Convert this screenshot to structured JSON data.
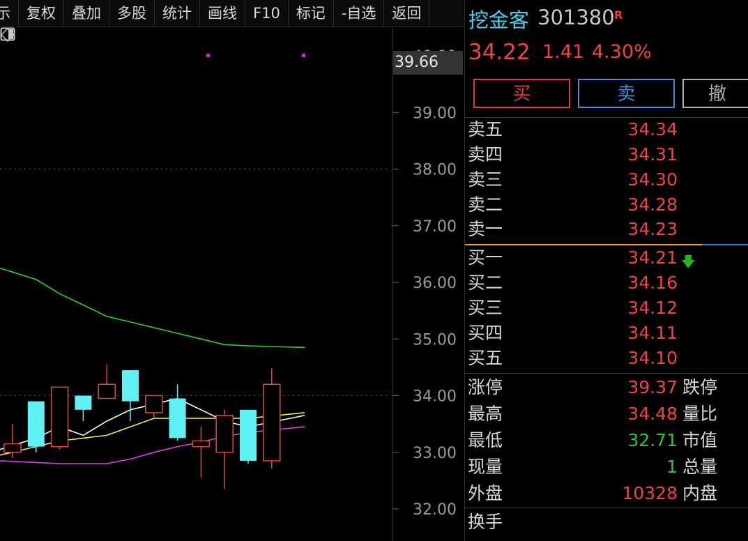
{
  "toolbar": {
    "items": [
      "示",
      "复权",
      "叠加",
      "多股",
      "统计",
      "画线",
      "F10",
      "标记",
      "-自选",
      "返回"
    ]
  },
  "chart": {
    "y_ticks": [
      "39.00",
      "38.00",
      "37.00",
      "36.00",
      "35.00",
      "34.00",
      "33.00",
      "32.00"
    ],
    "top_tick": "40.00",
    "current_label": "39.66",
    "colors": {
      "up": "#e04a3a",
      "down": "#5ff0f4",
      "ma_white": "#ffffff",
      "ma_yellow": "#f0f060",
      "ma_magenta": "#e040e0",
      "ma_green": "#30d030"
    }
  },
  "chart_data": {
    "type": "candlestick",
    "ylim": [
      32.0,
      40.0
    ],
    "candles": [
      {
        "o": 33.0,
        "c": 33.15,
        "h": 33.5,
        "l": 32.9,
        "dir": "up"
      },
      {
        "o": 33.9,
        "c": 33.1,
        "h": 33.9,
        "l": 33.0,
        "dir": "down"
      },
      {
        "o": 33.1,
        "c": 34.15,
        "h": 34.15,
        "l": 33.05,
        "dir": "up"
      },
      {
        "o": 34.0,
        "c": 33.75,
        "h": 34.0,
        "l": 33.55,
        "dir": "down"
      },
      {
        "o": 33.95,
        "c": 34.2,
        "h": 34.55,
        "l": 33.95,
        "dir": "up"
      },
      {
        "o": 34.45,
        "c": 33.9,
        "h": 34.45,
        "l": 33.55,
        "dir": "down"
      },
      {
        "o": 33.7,
        "c": 34.0,
        "h": 34.0,
        "l": 33.6,
        "dir": "up"
      },
      {
        "o": 33.95,
        "c": 33.25,
        "h": 34.2,
        "l": 33.2,
        "dir": "down"
      },
      {
        "o": 33.1,
        "c": 33.2,
        "h": 33.45,
        "l": 32.55,
        "dir": "up"
      },
      {
        "o": 33.0,
        "c": 33.65,
        "h": 33.75,
        "l": 32.35,
        "dir": "up"
      },
      {
        "o": 33.75,
        "c": 32.85,
        "h": 33.75,
        "l": 32.8,
        "dir": "down"
      },
      {
        "o": 32.85,
        "c": 34.2,
        "h": 34.48,
        "l": 32.71,
        "dir": "up"
      }
    ],
    "ma_white": [
      33.05,
      33.25,
      33.45,
      33.3,
      33.55,
      33.75,
      33.85,
      33.95,
      33.75,
      33.55,
      33.45,
      33.65
    ],
    "ma_yellow": [
      32.95,
      33.1,
      33.2,
      33.25,
      33.3,
      33.45,
      33.6,
      33.6,
      33.6,
      33.6,
      33.6,
      33.7
    ],
    "ma_magenta": [
      32.85,
      32.82,
      32.8,
      32.8,
      32.8,
      32.88,
      33.0,
      33.1,
      33.18,
      33.28,
      33.35,
      33.45
    ],
    "ma_green": [
      36.25,
      36.05,
      35.8,
      35.6,
      35.4,
      35.3,
      35.2,
      35.1,
      35.0,
      34.9,
      34.88,
      34.85
    ]
  },
  "quote": {
    "name": "挖金客",
    "code": "301380",
    "badge": "R",
    "price": "34.22",
    "change": "1.41",
    "change_pct": "4.30%"
  },
  "trade": {
    "buy": "买",
    "sell": "卖",
    "cancel": "撤"
  },
  "orderbook": {
    "asks": [
      {
        "label": "卖五",
        "price": "34.34"
      },
      {
        "label": "卖四",
        "price": "34.31"
      },
      {
        "label": "卖三",
        "price": "34.30"
      },
      {
        "label": "卖二",
        "price": "34.28"
      },
      {
        "label": "卖一",
        "price": "34.23"
      }
    ],
    "bids": [
      {
        "label": "买一",
        "price": "34.21"
      },
      {
        "label": "买二",
        "price": "34.16"
      },
      {
        "label": "买三",
        "price": "34.12"
      },
      {
        "label": "买四",
        "price": "34.11"
      },
      {
        "label": "买五",
        "price": "34.10"
      }
    ]
  },
  "stats": [
    {
      "label": "涨停",
      "value": "39.37",
      "color": "red",
      "label2": "跌停"
    },
    {
      "label": "最高",
      "value": "34.48",
      "color": "red",
      "label2": "量比"
    },
    {
      "label": "最低",
      "value": "32.71",
      "color": "green",
      "label2": "市值"
    },
    {
      "label": "现量",
      "value": "1",
      "color": "green",
      "label2": "总量"
    },
    {
      "label": "外盘",
      "value": "10328",
      "color": "red",
      "label2": "内盘"
    },
    {
      "label": "换手",
      "value": "",
      "color": "red",
      "label2": ""
    }
  ]
}
